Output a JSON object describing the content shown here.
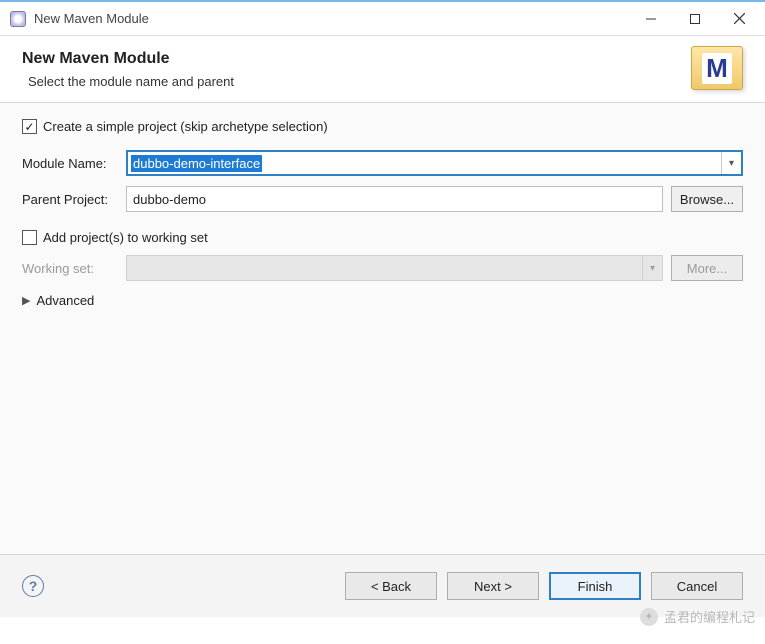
{
  "window": {
    "title": "New Maven Module"
  },
  "header": {
    "title": "New Maven Module",
    "subtitle": "Select the module name and parent",
    "icon_letter": "M"
  },
  "form": {
    "simple_project": {
      "label": "Create a simple project (skip archetype selection)",
      "checked": true
    },
    "module_name": {
      "label": "Module Name:",
      "value": "dubbo-demo-interface"
    },
    "parent_project": {
      "label": "Parent Project:",
      "value": "dubbo-demo",
      "browse_label": "Browse..."
    },
    "working_set": {
      "add_label": "Add project(s) to working set",
      "add_checked": false,
      "label": "Working set:",
      "more_label": "More..."
    },
    "advanced_label": "Advanced"
  },
  "footer": {
    "back": "< Back",
    "next": "Next >",
    "finish": "Finish",
    "cancel": "Cancel"
  },
  "watermark": "孟君的编程札记"
}
